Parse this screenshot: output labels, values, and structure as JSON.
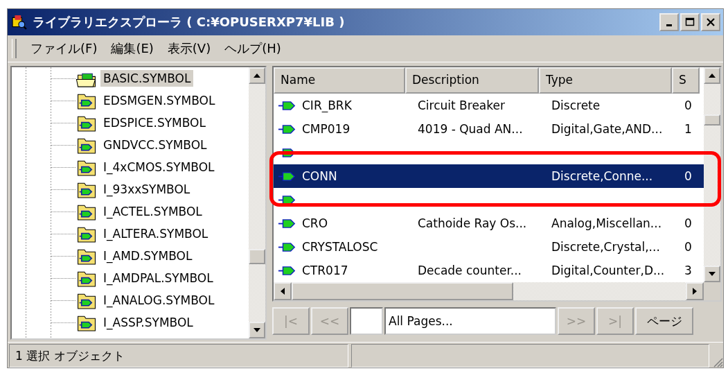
{
  "window": {
    "title": "ライブラリエクスプローラ ( C:¥OPUSERXP7¥LIB )"
  },
  "menu": [
    "ファイル(F)",
    "編集(E)",
    "表示(V)",
    "ヘルプ(H)"
  ],
  "tree": [
    {
      "label": "BASIC.SYMBOL",
      "selected": true,
      "kind": "open"
    },
    {
      "label": "EDSMGEN.SYMBOL",
      "selected": false,
      "kind": "closed"
    },
    {
      "label": "EDSPICE.SYMBOL",
      "selected": false,
      "kind": "closed"
    },
    {
      "label": "GNDVCC.SYMBOL",
      "selected": false,
      "kind": "closed"
    },
    {
      "label": "I_4xCMOS.SYMBOL",
      "selected": false,
      "kind": "closed"
    },
    {
      "label": "I_93xxSYMBOL",
      "selected": false,
      "kind": "closed"
    },
    {
      "label": "I_ACTEL.SYMBOL",
      "selected": false,
      "kind": "closed"
    },
    {
      "label": "I_ALTERA.SYMBOL",
      "selected": false,
      "kind": "closed"
    },
    {
      "label": "I_AMD.SYMBOL",
      "selected": false,
      "kind": "closed"
    },
    {
      "label": "I_AMDPAL.SYMBOL",
      "selected": false,
      "kind": "closed"
    },
    {
      "label": "I_ANALOG.SYMBOL",
      "selected": false,
      "kind": "closed"
    },
    {
      "label": "I_ASSP.SYMBOL",
      "selected": false,
      "kind": "closed"
    }
  ],
  "table": {
    "columns": [
      "Name",
      "Description",
      "Type",
      "S"
    ],
    "rows": [
      {
        "cells": [
          "CIR_BRK",
          "Circuit Breaker",
          "Discrete",
          "0"
        ],
        "selected": false
      },
      {
        "cells": [
          "CMP019",
          "4019 - Quad AN...",
          "Digital,Gate,AND...",
          "1"
        ],
        "selected": false
      },
      {
        "selected": false
      },
      {
        "cells": [
          "CONN",
          "",
          "Discrete,Conne...",
          "0"
        ],
        "selected": true
      },
      {
        "selected": false
      },
      {
        "cells": [
          "CRO",
          "Cathoide Ray Os...",
          "Analog,Miscellan...",
          "0"
        ],
        "selected": false
      },
      {
        "cells": [
          "CRYSTALOSC",
          "",
          "Discrete,Crystal,...",
          "0"
        ],
        "selected": false
      },
      {
        "cells": [
          "CTR017",
          "Decade counter...",
          "Digital,Counter,D...",
          "3"
        ],
        "selected": false
      }
    ]
  },
  "pager": {
    "buttons": [
      {
        "label": "|<",
        "disabled": true
      },
      {
        "label": "<<",
        "disabled": true
      }
    ],
    "pages_field": {
      "value": "All Pages..."
    },
    "buttons_after": [
      {
        "label": ">>",
        "disabled": true
      },
      {
        "label": ">|",
        "disabled": true
      },
      {
        "label": "ページ",
        "disabled": false
      }
    ]
  },
  "status_bar": {
    "text": "1 選択 オブジェクト"
  }
}
